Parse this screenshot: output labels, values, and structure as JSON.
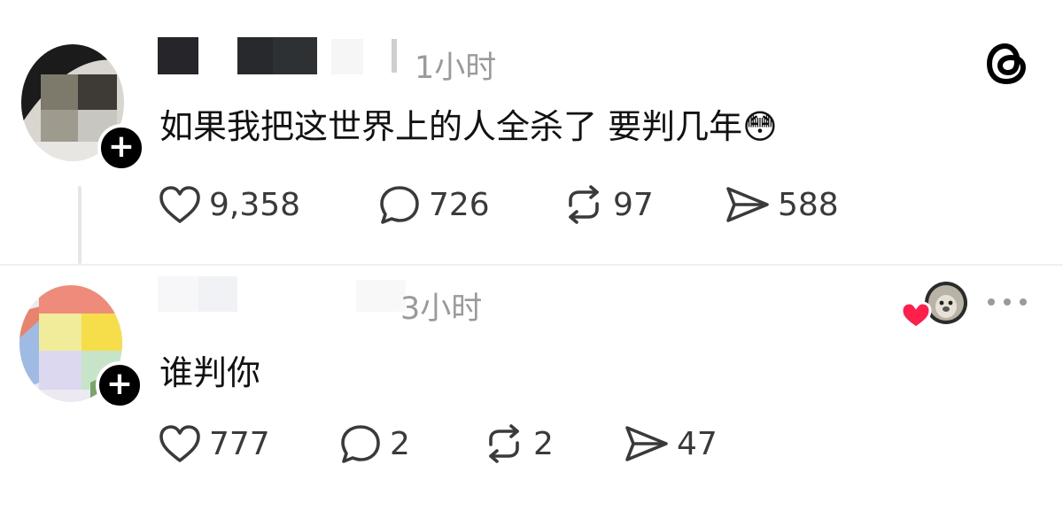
{
  "posts": [
    {
      "timestamp": "1小时",
      "text": "如果我把这世界上的人全杀了 要判几年",
      "emoji": "😳",
      "follow_badge": "+",
      "stats": {
        "likes": "9,358",
        "replies": "726",
        "reposts": "97",
        "shares": "588"
      }
    },
    {
      "timestamp": "3小时",
      "text": "谁判你",
      "follow_badge": "+",
      "stats": {
        "likes": "777",
        "replies": "2",
        "reposts": "2",
        "shares": "47"
      }
    }
  ],
  "icons": {
    "like": "heart-icon",
    "reply": "speech-bubble-icon",
    "repost": "repost-icon",
    "share": "send-icon",
    "logo": "threads-logo-icon",
    "more": "more-options-icon",
    "liked_by_author": "heart-icon"
  },
  "colors": {
    "text": "#111111",
    "muted": "#9a9a9a",
    "icon": "#3a3a3a",
    "like_red": "#ff1f4b",
    "thread_line": "#e6e6e6"
  }
}
